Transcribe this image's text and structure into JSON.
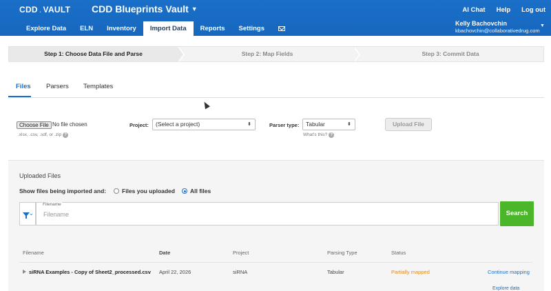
{
  "header": {
    "logo_left": "CDD",
    "logo_right": "VAULT",
    "vault_title": "CDD Blueprints Vault",
    "top_links": [
      "AI Chat",
      "Help",
      "Log out"
    ],
    "nav": [
      "Explore Data",
      "ELN",
      "Inventory",
      "Import Data",
      "Reports",
      "Settings"
    ],
    "active_nav": "Import Data",
    "user_name": "Kelly Bachovchin",
    "user_email": "kbachovchin@collaborativedrug.com"
  },
  "steps": [
    "Step 1: Choose Data File and Parse",
    "Step 2: Map Fields",
    "Step 3: Commit Data"
  ],
  "tabs": [
    "Files",
    "Parsers",
    "Templates"
  ],
  "upload": {
    "choose_file": "Choose File",
    "no_file": "No file chosen",
    "file_types": ".xlsx, .csv, .sdf, or .zip",
    "project_label": "Project:",
    "project_value": "(Select a project)",
    "parser_label": "Parser type:",
    "parser_value": "Tabular",
    "whats_this": "What's this?",
    "upload_button": "Upload File",
    "help_glyph": "?"
  },
  "uploaded": {
    "title": "Uploaded Files",
    "show_label": "Show files being imported and:",
    "radio_options": [
      "Files you uploaded",
      "All files"
    ],
    "selected_radio": "All files",
    "input_label": "Filename",
    "input_placeholder": "Filename",
    "search_button": "Search"
  },
  "table": {
    "columns": [
      "Filename",
      "Date",
      "Project",
      "Parsing Type",
      "Status"
    ],
    "rows": [
      {
        "filename": "siRNA Examples - Copy of Sheet2_processed.csv",
        "date": "April 22, 2026",
        "project": "siRNA",
        "parsing_type": "Tabular",
        "status": "Partially mapped",
        "action": "Continue mapping"
      }
    ],
    "extra_link": "Explore data"
  },
  "colors": {
    "header_blue": "#1a6fc8",
    "search_green": "#4cb62a",
    "status_orange": "#e08a1e"
  }
}
